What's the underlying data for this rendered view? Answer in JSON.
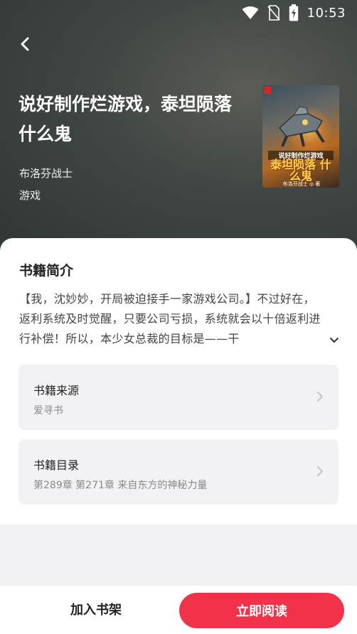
{
  "status_bar": {
    "time": "10:53",
    "icons": [
      "wifi-icon",
      "no-sim-icon",
      "battery-charging-icon"
    ]
  },
  "book": {
    "title": "说好制作烂游戏，泰坦陨落什么鬼",
    "author": "布洛芬战士",
    "genre": "游戏",
    "cover": {
      "subtitle": "说好制作烂游戏",
      "main_title": "泰坦陨落 什么鬼",
      "author_line": "布洛芬战士 ◎ 著"
    }
  },
  "intro": {
    "heading": "书籍简介",
    "text": "【我，沈妙妙，开局被迫接手一家游戏公司。】不过好在，返利系统及时觉醒，只要公司亏损，系统就会以十倍返利进行补偿！所以，本少女总裁的目标是——干"
  },
  "source": {
    "title": "书籍来源",
    "value": "爱寻书"
  },
  "catalog": {
    "title": "书籍目录",
    "value": "第289章 第271章 来自东方的神秘力量"
  },
  "actions": {
    "add_to_shelf": "加入书架",
    "read_now": "立即阅读"
  },
  "colors": {
    "accent": "#f2314a",
    "card_bg": "#f2f2f4"
  }
}
